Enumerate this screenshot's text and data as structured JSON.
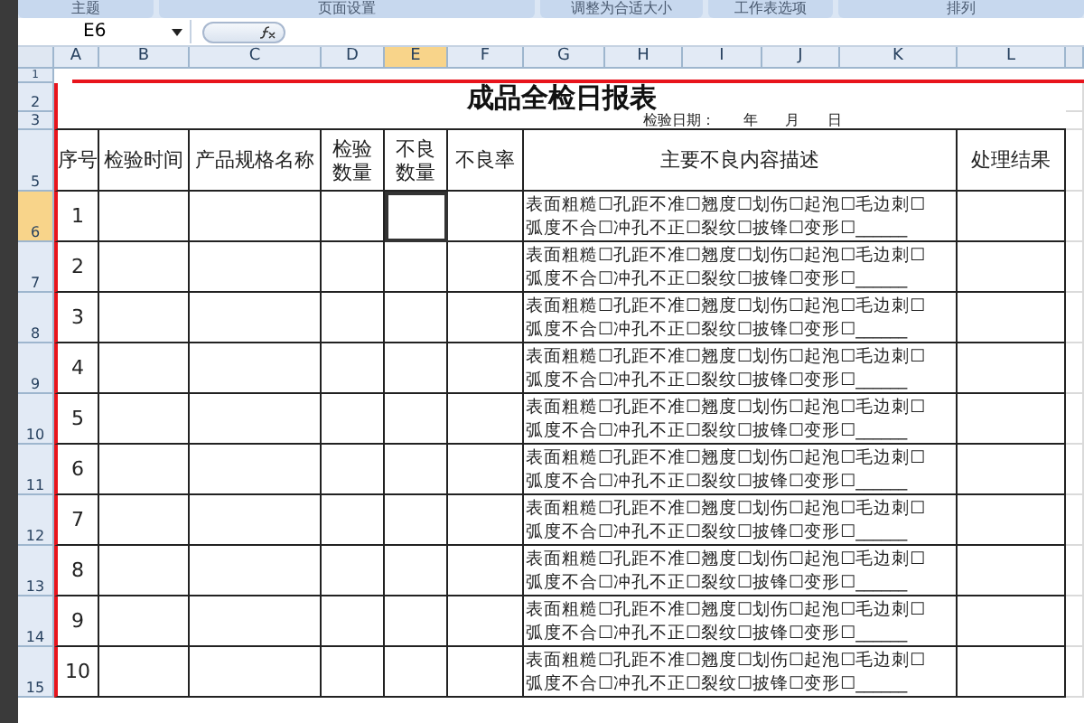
{
  "ribbon_groups": [
    "主题",
    "页面设置",
    "调整为合适大小",
    "工作表选项",
    "排列"
  ],
  "name_box": "E6",
  "column_headers": [
    {
      "label": "A",
      "selected": false
    },
    {
      "label": "B",
      "selected": false
    },
    {
      "label": "C",
      "selected": false
    },
    {
      "label": "D",
      "selected": false
    },
    {
      "label": "E",
      "selected": true
    },
    {
      "label": "F",
      "selected": false
    },
    {
      "label": "G",
      "selected": false
    },
    {
      "label": "H",
      "selected": false
    },
    {
      "label": "I",
      "selected": false
    },
    {
      "label": "J",
      "selected": false
    },
    {
      "label": "K",
      "selected": false
    },
    {
      "label": "L",
      "selected": false
    }
  ],
  "row_headers": [
    {
      "label": "1",
      "selected": false
    },
    {
      "label": "2",
      "selected": false
    },
    {
      "label": "3",
      "selected": false
    },
    {
      "label": "5",
      "selected": false
    },
    {
      "label": "6",
      "selected": true
    },
    {
      "label": "7",
      "selected": false
    },
    {
      "label": "8",
      "selected": false
    },
    {
      "label": "9",
      "selected": false
    },
    {
      "label": "10",
      "selected": false
    },
    {
      "label": "11",
      "selected": false
    },
    {
      "label": "12",
      "selected": false
    },
    {
      "label": "13",
      "selected": false
    },
    {
      "label": "14",
      "selected": false
    },
    {
      "label": "15",
      "selected": false
    }
  ],
  "title": "成品全检日报表",
  "date_line": "检验日期：      年      月      日",
  "table_headers": [
    "序号",
    "检验时间",
    "产品规格名称",
    "检验数量",
    "不良数量",
    "不良率",
    "主要不良内容描述",
    "处理结果"
  ],
  "rows": [
    {
      "no": "1",
      "description": [
        "表面粗糙☐孔距不准☐翘度☐划伤☐起泡☐毛边刺☐",
        "弧度不合☐冲孔不正☐裂纹☐披锋☐变形☐______"
      ],
      "defect_qty_selected": true
    },
    {
      "no": "2",
      "description": [
        "表面粗糙☐孔距不准☐翘度☐划伤☐起泡☐毛边刺☐",
        "弧度不合☐冲孔不正☐裂纹☐披锋☐变形☐______"
      ],
      "defect_qty_selected": false
    },
    {
      "no": "3",
      "description": [
        "表面粗糙☐孔距不准☐翘度☐划伤☐起泡☐毛边刺☐",
        "弧度不合☐冲孔不正☐裂纹☐披锋☐变形☐______"
      ],
      "defect_qty_selected": false
    },
    {
      "no": "4",
      "description": [
        "表面粗糙☐孔距不准☐翘度☐划伤☐起泡☐毛边刺☐",
        "弧度不合☐冲孔不正☐裂纹☐披锋☐变形☐______"
      ],
      "defect_qty_selected": false
    },
    {
      "no": "5",
      "description": [
        "表面粗糙☐孔距不准☐翘度☐划伤☐起泡☐毛边刺☐",
        "弧度不合☐冲孔不正☐裂纹☐披锋☐变形☐______"
      ],
      "defect_qty_selected": false
    },
    {
      "no": "6",
      "description": [
        "表面粗糙☐孔距不准☐翘度☐划伤☐起泡☐毛边刺☐",
        "弧度不合☐冲孔不正☐裂纹☐披锋☐变形☐______"
      ],
      "defect_qty_selected": false
    },
    {
      "no": "7",
      "description": [
        "表面粗糙☐孔距不准☐翘度☐划伤☐起泡☐毛边刺☐",
        "弧度不合☐冲孔不正☐裂纹☐披锋☐变形☐______"
      ],
      "defect_qty_selected": false
    },
    {
      "no": "8",
      "description": [
        "表面粗糙☐孔距不准☐翘度☐划伤☐起泡☐毛边刺☐",
        "弧度不合☐冲孔不正☐裂纹☐披锋☐变形☐______"
      ],
      "defect_qty_selected": false
    },
    {
      "no": "9",
      "description": [
        "表面粗糙☐孔距不准☐翘度☐划伤☐起泡☐毛边刺☐",
        "弧度不合☐冲孔不正☐裂纹☐披锋☐变形☐______"
      ],
      "defect_qty_selected": false
    },
    {
      "no": "10",
      "description": [
        "表面粗糙☐孔距不准☐翘度☐划伤☐起泡☐毛边刺☐",
        "弧度不合☐冲孔不正☐裂纹☐披锋☐变形☐______"
      ],
      "defect_qty_selected": false
    }
  ]
}
